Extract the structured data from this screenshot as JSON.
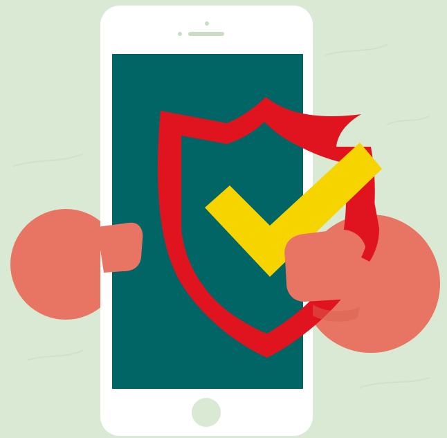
{
  "illustration": {
    "subject": "phone-with-security-shield",
    "icons": [
      "phone-icon",
      "shield-icon",
      "checkmark-icon",
      "hand-icon"
    ],
    "colors": {
      "background": "#d9e9d3",
      "background_texture": "#c8dbc2",
      "phone_body": "#ffffff",
      "phone_screen": "#006564",
      "shield": "#e0141e",
      "checkmark": "#f5d400",
      "hand": "#e87563",
      "hand_shadow": "#d9624f",
      "home_button": "#d9e9d3"
    }
  }
}
